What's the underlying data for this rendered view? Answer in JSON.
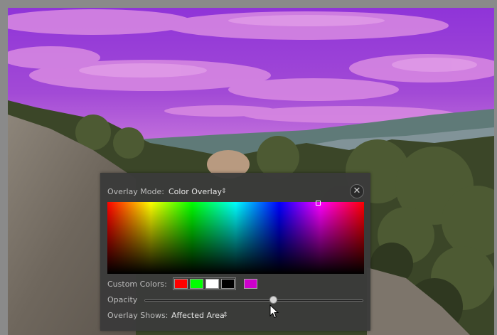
{
  "overlay_mode": {
    "label": "Overlay Mode:",
    "value": "Color Overlay",
    "updown_icon": "⇕"
  },
  "close_icon": "✕",
  "color_picker": {
    "selected_color": "#cc00cc"
  },
  "custom_colors": {
    "label": "Custom Colors:",
    "swatches": [
      "#ff0000",
      "#00ff00",
      "#ffffff",
      "#000000"
    ],
    "current": "#cc00cc"
  },
  "opacity": {
    "label": "Opacity",
    "value": 0.59
  },
  "overlay_shows": {
    "label": "Overlay Shows:",
    "value": "Affected Area",
    "updown_icon": "⇕"
  }
}
